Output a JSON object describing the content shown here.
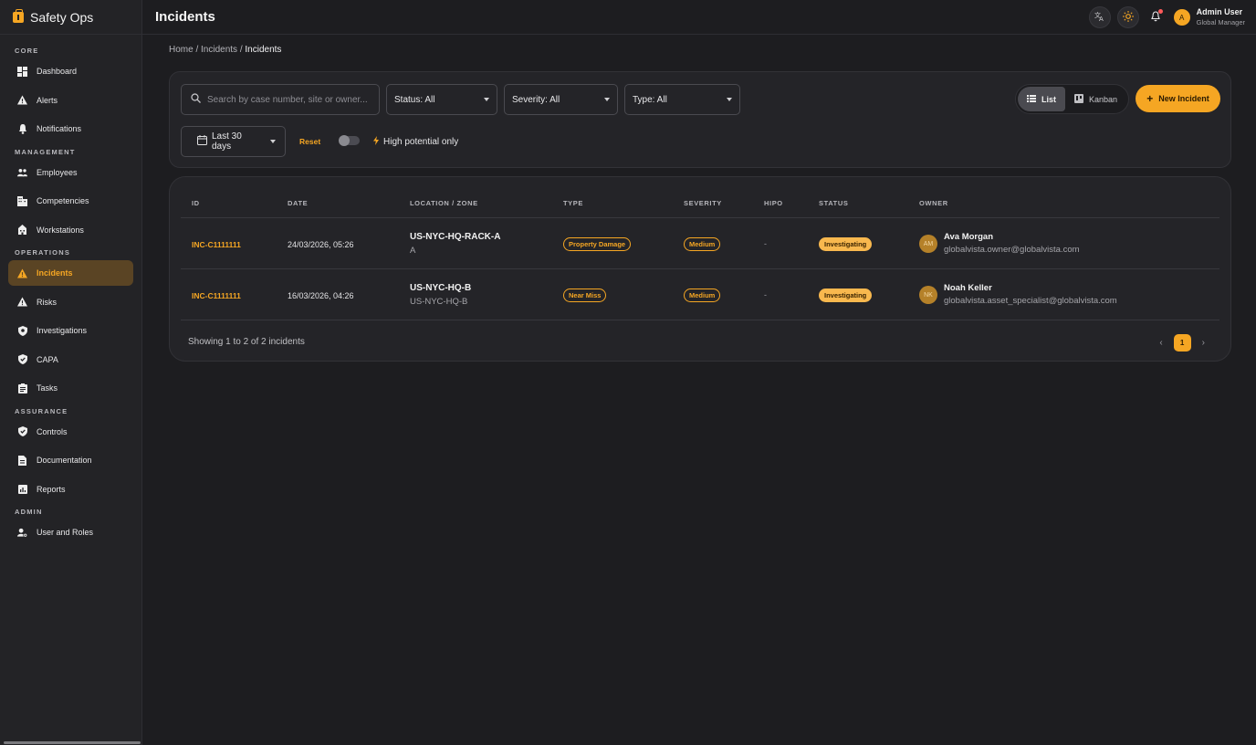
{
  "brand": {
    "name": "Safety Ops",
    "icon": "briefcase-medical-icon",
    "accent": "#f5a623"
  },
  "header": {
    "title": "Incidents"
  },
  "topbar": {
    "user_name": "Admin User",
    "user_role": "Global Manager",
    "avatar_initial": "A",
    "icons": [
      "translate-icon",
      "sun-icon",
      "bell-icon"
    ]
  },
  "sidebar": {
    "sections": [
      {
        "label": "CORE",
        "items": [
          {
            "label": "Dashboard",
            "icon": "dashboard-icon"
          },
          {
            "label": "Alerts",
            "icon": "warning-icon"
          },
          {
            "label": "Notifications",
            "icon": "bell-icon"
          }
        ]
      },
      {
        "label": "MANAGEMENT",
        "items": [
          {
            "label": "Employees",
            "icon": "people-icon"
          },
          {
            "label": "Competencies",
            "icon": "building-icon"
          },
          {
            "label": "Workstations",
            "icon": "workstation-icon"
          }
        ]
      },
      {
        "label": "OPERATIONS",
        "items": [
          {
            "label": "Incidents",
            "icon": "warning-icon",
            "active": true
          },
          {
            "label": "Risks",
            "icon": "warning-icon"
          },
          {
            "label": "Investigations",
            "icon": "shield-search-icon"
          },
          {
            "label": "CAPA",
            "icon": "shield-check-icon"
          },
          {
            "label": "Tasks",
            "icon": "clipboard-icon"
          }
        ]
      },
      {
        "label": "ASSURANCE",
        "items": [
          {
            "label": "Controls",
            "icon": "shield-check-icon"
          },
          {
            "label": "Documentation",
            "icon": "document-icon"
          },
          {
            "label": "Reports",
            "icon": "chart-icon"
          }
        ]
      },
      {
        "label": "ADMIN",
        "items": [
          {
            "label": "User and Roles",
            "icon": "user-settings-icon"
          }
        ]
      }
    ]
  },
  "breadcrumb": {
    "items": [
      "Home",
      "Incidents"
    ],
    "current": "Incidents",
    "separator": "/"
  },
  "filters": {
    "search_placeholder": "Search by case number, site or owner...",
    "status": "Status: All",
    "severity": "Severity: All",
    "type": "Type: All",
    "date_range": "Last 30 days",
    "reset": "Reset",
    "hipo_label": "High potential only",
    "hipo_on": false
  },
  "view": {
    "list": "List",
    "kanban": "Kanban",
    "active": "list"
  },
  "actions": {
    "new_incident": "New Incident"
  },
  "table": {
    "columns": [
      "ID",
      "DATE",
      "LOCATION / ZONE",
      "TYPE",
      "SEVERITY",
      "HIPO",
      "STATUS",
      "OWNER"
    ],
    "rows": [
      {
        "id": "INC-C1111111",
        "date": "24/03/2026, 05:26",
        "location": "US-NYC-HQ-RACK-A",
        "zone": "A",
        "type": "Property Damage",
        "severity": "Medium",
        "hipo": "-",
        "status": "Investigating",
        "owner_initials": "AM",
        "owner_name": "Ava Morgan",
        "owner_email": "globalvista.owner@globalvista.com"
      },
      {
        "id": "INC-C1111111",
        "date": "16/03/2026, 04:26",
        "location": "US-NYC-HQ-B",
        "zone": "US-NYC-HQ-B",
        "type": "Near Miss",
        "severity": "Medium",
        "hipo": "-",
        "status": "Investigating",
        "owner_initials": "NK",
        "owner_name": "Noah Keller",
        "owner_email": "globalvista.asset_specialist@globalvista.com"
      }
    ],
    "footer": "Showing 1 to 2 of 2 incidents",
    "page": "1",
    "prev": "‹",
    "next": "›"
  }
}
